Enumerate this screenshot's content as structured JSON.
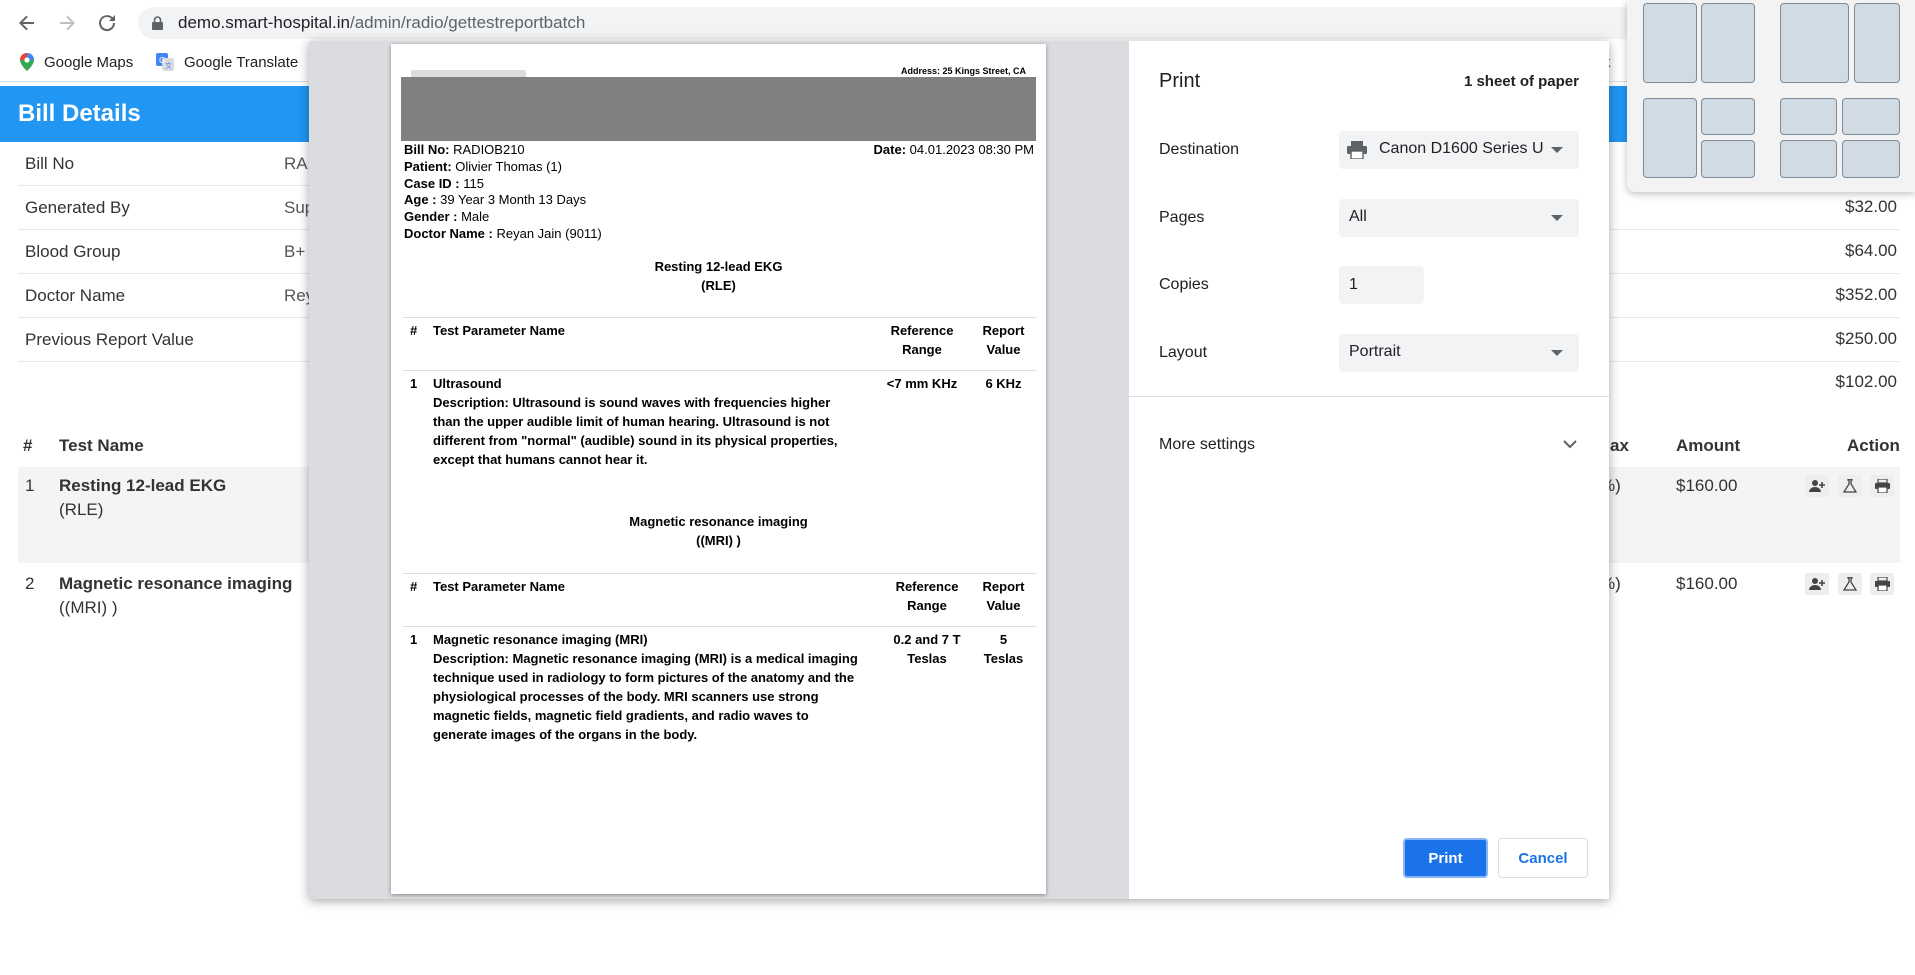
{
  "browser": {
    "url_host": "demo.smart-hospital.in",
    "url_path": "/admin/radio/gettestreportbatch",
    "bookmarks": [
      {
        "label": "Google Maps",
        "icon": "map-pin-icon"
      },
      {
        "label": "Google Translate",
        "icon": "translate-icon"
      }
    ],
    "bookmark_truncated": "ick"
  },
  "page": {
    "title": "Bill Details",
    "info": [
      {
        "label": "Bill No",
        "value": "RAI"
      },
      {
        "label": "Generated By",
        "value": "Sup"
      },
      {
        "label": "Blood Group",
        "value": "B+"
      },
      {
        "label": "Doctor Name",
        "value": "Rey"
      },
      {
        "label": "Previous Report Value",
        "value": ""
      }
    ],
    "amounts": [
      "$32.00",
      "$64.00",
      "$352.00",
      "$250.00",
      "$102.00"
    ],
    "table": {
      "headers": {
        "num": "#",
        "name": "Test Name",
        "tax": "ax",
        "amount": "Amount",
        "action": "Action"
      },
      "rows": [
        {
          "num": "1",
          "name": "Resting 12-lead EKG",
          "sub": "(RLE)",
          "tax": "%)",
          "amount": "$160.00"
        },
        {
          "num": "2",
          "name": "Magnetic resonance imaging",
          "sub": "((MRI) )",
          "tax": "%)",
          "amount": "$160.00"
        }
      ]
    }
  },
  "report": {
    "address": "Address: 25 Kings Street, CA",
    "bill_no_label": "Bill No:",
    "bill_no": "RADIOB210",
    "date_label": "Date:",
    "date": "04.01.2023 08:30 PM",
    "patient_label": "Patient:",
    "patient": "Olivier Thomas (1)",
    "case_label": "Case ID :",
    "case_id": "115",
    "age_label": "Age :",
    "age": "39 Year 3 Month 13 Days",
    "gender_label": "Gender :",
    "gender": "Male",
    "doctor_label": "Doctor Name :",
    "doctor": "Reyan Jain (9011)",
    "col_num": "#",
    "col_param": "Test Parameter Name",
    "col_ref_1": "Reference",
    "col_ref_2": "Range",
    "col_val_1": "Report",
    "col_val_2": "Value",
    "section1": {
      "title_1": "Resting 12-lead EKG",
      "title_2": "(RLE)",
      "num": "1",
      "param": "Ultrasound",
      "desc_lines": [
        "Description: Ultrasound is sound waves with frequencies higher",
        "than the upper audible limit of human hearing. Ultrasound is not",
        "different from \"normal\" (audible) sound in its physical properties,",
        "except that humans cannot hear it."
      ],
      "ref": "<7 mm KHz",
      "value": "6 KHz"
    },
    "section2": {
      "title_1": "Magnetic resonance imaging",
      "title_2": "((MRI) )",
      "num": "1",
      "param": "Magnetic resonance imaging (MRI)",
      "desc_lines": [
        "Description: Magnetic resonance imaging (MRI) is a medical imaging",
        "technique used in radiology to form pictures of the anatomy and the",
        "physiological processes of the body. MRI scanners use strong",
        "magnetic fields, magnetic field gradients, and radio waves to",
        "generate images of the organs in the body."
      ],
      "ref_1": "0.2 and 7 T",
      "ref_2": "Teslas",
      "value_1": "5",
      "value_2": "Teslas"
    }
  },
  "print": {
    "title": "Print",
    "sheets": "1 sheet of paper",
    "destination_label": "Destination",
    "destination_value": "Canon D1600 Series U",
    "pages_label": "Pages",
    "pages_value": "All",
    "copies_label": "Copies",
    "copies_value": "1",
    "layout_label": "Layout",
    "layout_value": "Portrait",
    "more_settings": "More settings",
    "print_button": "Print",
    "cancel_button": "Cancel"
  },
  "colors": {
    "header_blue": "#2196f3",
    "print_button": "#1a73e8",
    "report_banner": "#808080"
  }
}
